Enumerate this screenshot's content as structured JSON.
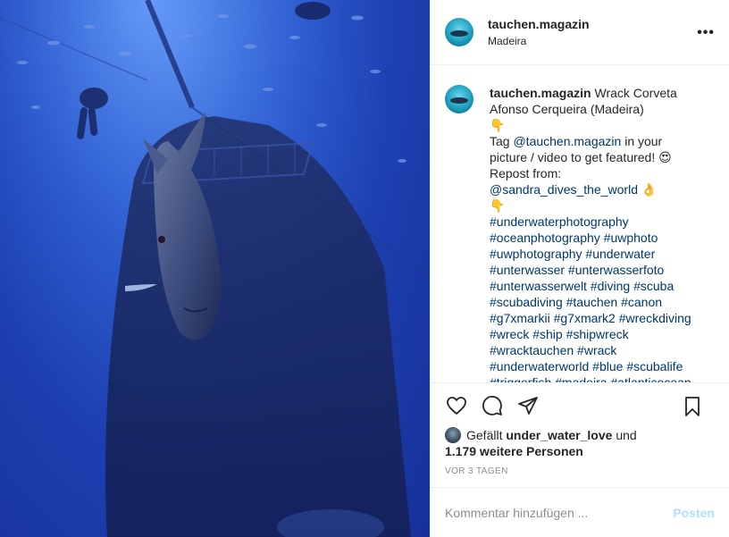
{
  "post": {
    "username": "tauchen.magazin",
    "location": "Madeira",
    "more_icon": "more-horizontal-icon",
    "photo_icon": "underwater-wreck-photo"
  },
  "caption": {
    "username": "tauchen.magazin",
    "title_1": "Wrack Corveta",
    "title_2": "Afonso Cerqueira (Madeira)",
    "emoji_point_down": "👇",
    "line_tag_prefix": "Tag ",
    "tag_mention": "@tauchen.magazin",
    "line_tag_suffix": " in your",
    "line_picture": "picture / video to get featured! 😍",
    "line_repost": "Repost from:",
    "repost_mention": "@sandra_dives_the_world",
    "emoji_ok": " 👌",
    "emoji_point_down_2": "👇",
    "hashtag_lines": [
      "#underwaterphotography",
      "#oceanphotography #uwphoto",
      "#uwphotography #underwater",
      "#unterwasser #unterwasserfoto",
      "#unterwasserwelt #diving #scuba",
      "#scubadiving #tauchen #canon",
      "#g7xmarkii #g7xmark2 #wreckdiving",
      "#wreck #ship #shipwreck",
      "#wracktauchen #wrack",
      "#underwaterworld #blue #scubalife",
      "#triggerfish #madeira #atlanticocean"
    ]
  },
  "actions": {
    "like_icon": "heart-icon",
    "comment_icon": "comment-icon",
    "share_icon": "share-icon",
    "save_icon": "bookmark-icon"
  },
  "likes": {
    "prefix": "Gefällt",
    "user": "under_water_love",
    "conjunction": "und",
    "others": "1.179 weitere Personen"
  },
  "timestamp": "VOR 3 TAGEN",
  "comment_box": {
    "placeholder": "Kommentar hinzufügen ...",
    "post_label": "Posten"
  }
}
